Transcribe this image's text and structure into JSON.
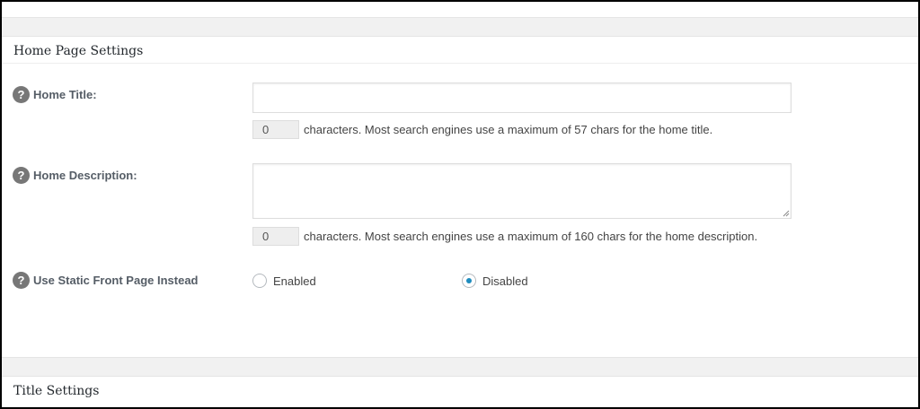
{
  "home_settings": {
    "header": "Home Page Settings",
    "home_title": {
      "label": "Home Title:",
      "value": "",
      "count": "0",
      "note": "characters. Most search engines use a maximum of 57 chars for the home title."
    },
    "home_description": {
      "label": "Home Description:",
      "value": "",
      "count": "0",
      "note": "characters. Most search engines use a maximum of 160 chars for the home description."
    },
    "static_front_page": {
      "label": "Use Static Front Page Instead",
      "options": [
        {
          "label": "Enabled",
          "checked": false
        },
        {
          "label": "Disabled",
          "checked": true
        }
      ]
    }
  },
  "title_settings": {
    "header": "Title Settings"
  },
  "icons": {
    "help": "help-icon"
  },
  "colors": {
    "radio_checked": "#1e8cbe",
    "help_icon_bg": "#777777"
  }
}
